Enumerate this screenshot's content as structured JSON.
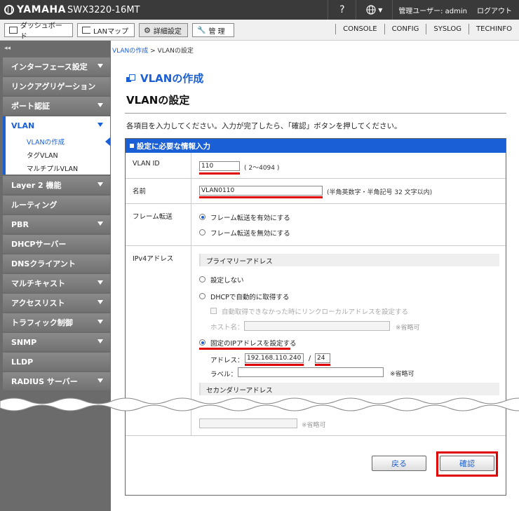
{
  "header": {
    "brand": "YAMAHA",
    "model": "SWX3220-16MT",
    "help": "?",
    "user_label": "管理ユーザー: admin",
    "logout": "ログアウト"
  },
  "toolbar": {
    "dashboard": "ダッシュボード",
    "lanmap": "LANマップ",
    "detail_settings": "詳細設定",
    "management": "管 理",
    "console": "CONSOLE",
    "config": "CONFIG",
    "syslog": "SYSLOG",
    "techinfo": "TECHINFO"
  },
  "sidebar": {
    "collapse": "◂◂",
    "items": [
      {
        "label": "インターフェース設定"
      },
      {
        "label": "リンクアグリゲーション"
      },
      {
        "label": "ポート認証"
      },
      {
        "label": "VLAN"
      },
      {
        "label": "Layer 2 機能"
      },
      {
        "label": "ルーティング"
      },
      {
        "label": "PBR"
      },
      {
        "label": "DHCPサーバー"
      },
      {
        "label": "DNSクライアント"
      },
      {
        "label": "マルチキャスト"
      },
      {
        "label": "アクセスリスト"
      },
      {
        "label": "トラフィック制御"
      },
      {
        "label": "SNMP"
      },
      {
        "label": "LLDP"
      },
      {
        "label": "RADIUS サーバー"
      }
    ],
    "vlan_sub": [
      "VLANの作成",
      "タグVLAN",
      "マルチプルVLAN"
    ]
  },
  "breadcrumb": {
    "parent": "VLANの作成",
    "sep": " > ",
    "current": "VLANの設定"
  },
  "page": {
    "title": "VLANの作成",
    "section": "VLANの設定",
    "instructions": "各項目を入力してください。入力が完了したら、「確認」ボタンを押してください。"
  },
  "form": {
    "header": "設定に必要な情報入力",
    "vlan_id_label": "VLAN ID",
    "vlan_id_value": "110",
    "vlan_id_hint": "( 2～4094 )",
    "name_label": "名前",
    "name_value": "VLAN0110",
    "name_hint": "(半角英数字・半角記号 32 文字以内)",
    "frame_label": "フレーム転送",
    "frame_enable": "フレーム転送を有効にする",
    "frame_disable": "フレーム転送を無効にする",
    "ipv4_label": "IPv4アドレス",
    "primary_head": "プライマリーアドレス",
    "opt_none": "設定しない",
    "opt_dhcp": "DHCPで自動的に取得する",
    "opt_linklocal": "自動取得できなかった時にリンクローカルアドレスを設定する",
    "hostname_label": "ホスト名：",
    "optional": "※省略可",
    "opt_static": "固定のIPアドレスを設定する",
    "address_label": "アドレス：",
    "address_value": "192.168.110.240",
    "slash": "/",
    "prefix_value": "24",
    "label_label": "ラベル：",
    "secondary_head": "セカンダリーアドレス"
  },
  "buttons": {
    "back": "戻る",
    "confirm": "確認"
  },
  "colors": {
    "accent": "#1a5fd6",
    "highlight": "#e00000",
    "sidebar": "#6b6b6b"
  }
}
